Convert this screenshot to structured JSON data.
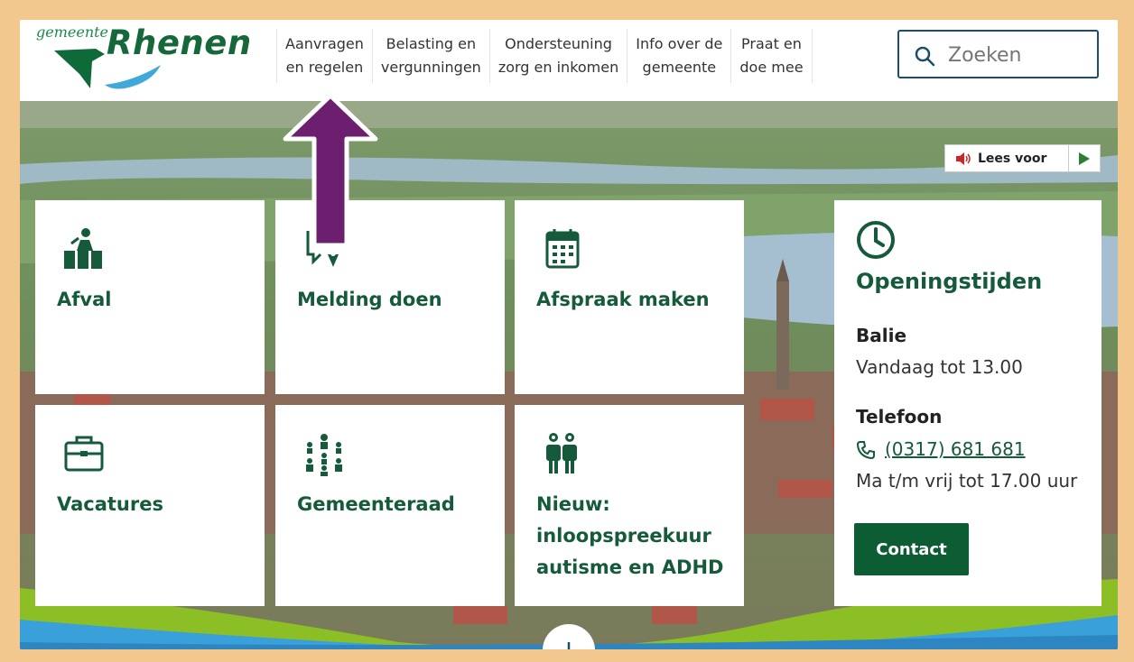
{
  "header": {
    "logo_small": "gemeente",
    "logo_big": "Rhenen",
    "nav": [
      {
        "line1": "Aanvragen",
        "line2": "en regelen"
      },
      {
        "line1": "Belasting en",
        "line2": "vergunningen"
      },
      {
        "line1": "Ondersteuning",
        "line2": "zorg en inkomen"
      },
      {
        "line1": "Info over de",
        "line2": "gemeente"
      },
      {
        "line1": "Praat en",
        "line2": "doe mee"
      }
    ],
    "search_placeholder": "Zoeken"
  },
  "readspeaker": {
    "label": "Lees voor"
  },
  "tiles": [
    {
      "label": "Afval",
      "icon": "waste-bins-icon"
    },
    {
      "label": "Melding doen",
      "icon": "report-location-icon"
    },
    {
      "label": "Afspraak maken",
      "icon": "calendar-icon"
    },
    {
      "label": "Vacatures",
      "icon": "briefcase-icon"
    },
    {
      "label": "Gemeenteraad",
      "icon": "council-icon"
    },
    {
      "label_l1": "Nieuw:",
      "label_l2": "inloopspreekuur",
      "label_l3": "autisme en ADHD",
      "icon": "people-icon"
    }
  ],
  "openings": {
    "title": "Openingstijden",
    "balie_label": "Balie",
    "balie_text": "Vandaag tot 13.00",
    "telefoon_label": "Telefoon",
    "phone": "(0317) 681 681",
    "phone_hours": "Ma t/m vrij tot 17.00 uur",
    "contact_button": "Contact"
  },
  "colors": {
    "brand_green": "#155a3a",
    "button_green": "#0c5c34",
    "frame_border": "#f3c88f",
    "annotation_arrow": "#6b1f6e"
  }
}
